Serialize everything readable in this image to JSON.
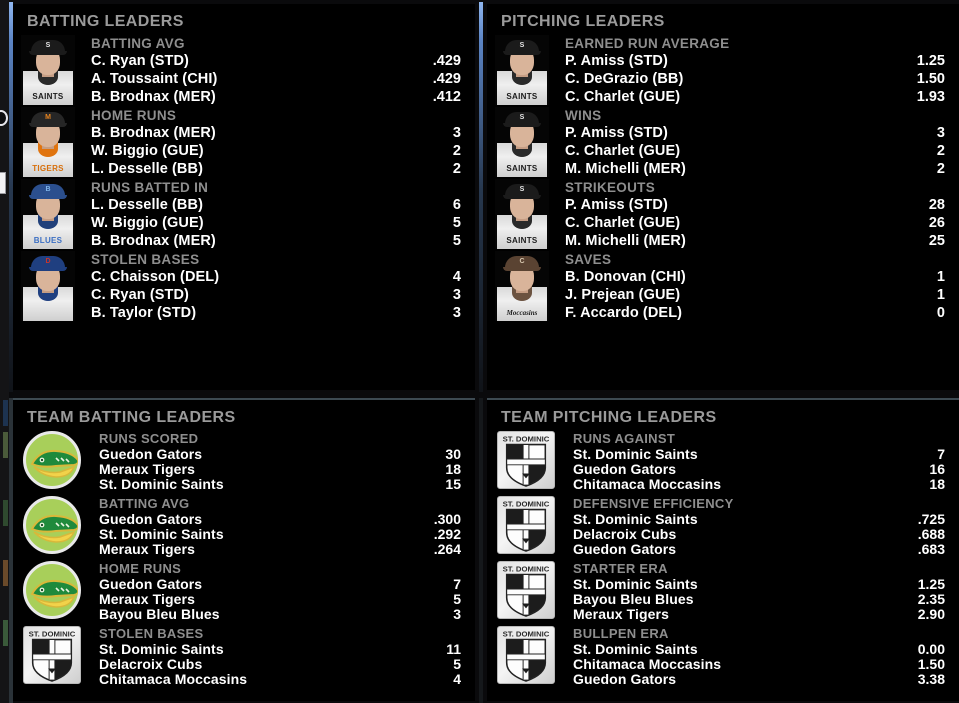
{
  "panels": {
    "batting": {
      "title": "BATTING LEADERS",
      "groups": [
        {
          "category": "BATTING AVG",
          "team": "saints",
          "rows": [
            {
              "name": "C. Ryan (STD)",
              "value": ".429"
            },
            {
              "name": "A. Toussaint (CHI)",
              "value": ".429"
            },
            {
              "name": "B. Brodnax (MER)",
              "value": ".412"
            }
          ]
        },
        {
          "category": "HOME RUNS",
          "team": "tigers",
          "rows": [
            {
              "name": "B. Brodnax (MER)",
              "value": "3"
            },
            {
              "name": "W. Biggio (GUE)",
              "value": "2"
            },
            {
              "name": "L. Desselle (BB)",
              "value": "2"
            }
          ]
        },
        {
          "category": "RUNS BATTED IN",
          "team": "blues",
          "rows": [
            {
              "name": "L. Desselle (BB)",
              "value": "6"
            },
            {
              "name": "W. Biggio (GUE)",
              "value": "5"
            },
            {
              "name": "B. Brodnax (MER)",
              "value": "5"
            }
          ]
        },
        {
          "category": "STOLEN BASES",
          "team": "cubs",
          "rows": [
            {
              "name": "C. Chaisson (DEL)",
              "value": "4"
            },
            {
              "name": "C. Ryan (STD)",
              "value": "3"
            },
            {
              "name": "B. Taylor (STD)",
              "value": "3"
            }
          ]
        }
      ]
    },
    "pitching": {
      "title": "PITCHING LEADERS",
      "groups": [
        {
          "category": "EARNED RUN AVERAGE",
          "team": "saints",
          "rows": [
            {
              "name": "P. Amiss (STD)",
              "value": "1.25"
            },
            {
              "name": "C. DeGrazio (BB)",
              "value": "1.50"
            },
            {
              "name": "C. Charlet (GUE)",
              "value": "1.93"
            }
          ]
        },
        {
          "category": "WINS",
          "team": "saints",
          "rows": [
            {
              "name": "P. Amiss (STD)",
              "value": "3"
            },
            {
              "name": "C. Charlet (GUE)",
              "value": "2"
            },
            {
              "name": "M. Michelli (MER)",
              "value": "2"
            }
          ]
        },
        {
          "category": "STRIKEOUTS",
          "team": "saints",
          "rows": [
            {
              "name": "P. Amiss (STD)",
              "value": "28"
            },
            {
              "name": "C. Charlet (GUE)",
              "value": "26"
            },
            {
              "name": "M. Michelli (MER)",
              "value": "25"
            }
          ]
        },
        {
          "category": "SAVES",
          "team": "moccasins",
          "rows": [
            {
              "name": "B. Donovan (CHI)",
              "value": "1"
            },
            {
              "name": "J. Prejean (GUE)",
              "value": "1"
            },
            {
              "name": "F. Accardo (DEL)",
              "value": "0"
            }
          ]
        }
      ]
    },
    "team_batting": {
      "title": "TEAM BATTING LEADERS",
      "groups": [
        {
          "category": "RUNS SCORED",
          "logo": "gators",
          "rows": [
            {
              "name": "Guedon Gators",
              "value": "30"
            },
            {
              "name": "Meraux Tigers",
              "value": "18"
            },
            {
              "name": "St. Dominic Saints",
              "value": "15"
            }
          ]
        },
        {
          "category": "BATTING AVG",
          "logo": "gators",
          "rows": [
            {
              "name": "Guedon Gators",
              "value": ".300"
            },
            {
              "name": "St. Dominic Saints",
              "value": ".292"
            },
            {
              "name": "Meraux Tigers",
              "value": ".264"
            }
          ]
        },
        {
          "category": "HOME RUNS",
          "logo": "gators",
          "rows": [
            {
              "name": "Guedon Gators",
              "value": "7"
            },
            {
              "name": "Meraux Tigers",
              "value": "5"
            },
            {
              "name": "Bayou Bleu Blues",
              "value": "3"
            }
          ]
        },
        {
          "category": "STOLEN BASES",
          "logo": "stdominic",
          "rows": [
            {
              "name": "St. Dominic Saints",
              "value": "11"
            },
            {
              "name": "Delacroix Cubs",
              "value": "5"
            },
            {
              "name": "Chitamaca Moccasins",
              "value": "4"
            }
          ]
        }
      ]
    },
    "team_pitching": {
      "title": "TEAM PITCHING LEADERS",
      "groups": [
        {
          "category": "RUNS AGAINST",
          "logo": "stdominic",
          "rows": [
            {
              "name": "St. Dominic Saints",
              "value": "7"
            },
            {
              "name": "Guedon Gators",
              "value": "16"
            },
            {
              "name": "Chitamaca Moccasins",
              "value": "18"
            }
          ]
        },
        {
          "category": "DEFENSIVE EFFICIENCY",
          "logo": "stdominic",
          "rows": [
            {
              "name": "St. Dominic Saints",
              "value": ".725"
            },
            {
              "name": "Delacroix Cubs",
              "value": ".688"
            },
            {
              "name": "Guedon Gators",
              "value": ".683"
            }
          ]
        },
        {
          "category": "STARTER ERA",
          "logo": "stdominic",
          "rows": [
            {
              "name": "St. Dominic Saints",
              "value": "1.25"
            },
            {
              "name": "Bayou Bleu Blues",
              "value": "2.35"
            },
            {
              "name": "Meraux Tigers",
              "value": "2.90"
            }
          ]
        },
        {
          "category": "BULLPEN ERA",
          "logo": "stdominic",
          "rows": [
            {
              "name": "St. Dominic Saints",
              "value": "0.00"
            },
            {
              "name": "Chitamaca Moccasins",
              "value": "1.50"
            },
            {
              "name": "Guedon Gators",
              "value": "3.38"
            }
          ]
        }
      ]
    }
  },
  "uniforms": {
    "saints": {
      "jersey_name": "SAINTS",
      "cap": "#1b1b1b",
      "trim": "#2a2a2a",
      "logo": "S",
      "logo_color": "#e8e8e8"
    },
    "tigers": {
      "jersey_name": "TIGERS",
      "cap": "#262626",
      "trim": "#e0740f",
      "logo": "M",
      "logo_color": "#e8841f"
    },
    "blues": {
      "jersey_name": "BLUES",
      "cap": "#2b4f8e",
      "trim": "#21407a",
      "logo": "B",
      "logo_color": "#7fb3e8"
    },
    "cubs": {
      "jersey_name": "",
      "cap": "#1f3f80",
      "trim": "#1f3f80",
      "logo": "D",
      "logo_color": "#c8342c"
    },
    "moccasins": {
      "jersey_name": "Moccasins",
      "cap": "#5a4332",
      "trim": "#6b5240",
      "logo": "C",
      "logo_color": "#d8c8b0"
    }
  },
  "logo_colors": {
    "gators_body": "#1f8a3c",
    "gators_outline": "#d8b83a",
    "gators_field": "#a8cf5a",
    "stdominic_label": "ST. DOMINIC"
  }
}
